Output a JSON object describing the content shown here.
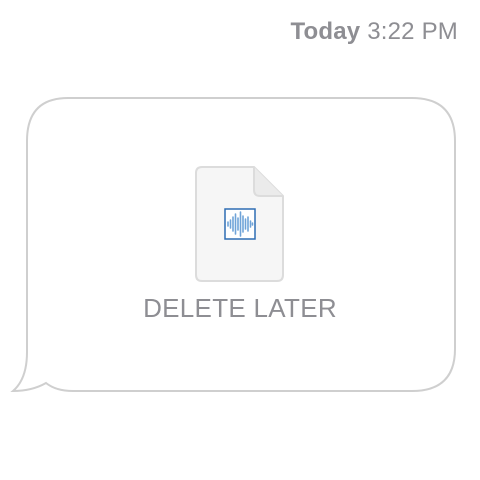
{
  "conversation": {
    "timestamp": {
      "day": "Today",
      "time": "3:22 PM"
    }
  },
  "message": {
    "attachment": {
      "type_icon": "audio-file-icon",
      "name": "DELETE LATER"
    }
  },
  "colors": {
    "bubble_border": "#cfcfcf",
    "meta_text": "#8e8e93",
    "file_fill": "#f6f6f6",
    "file_border": "#dcdcdc",
    "waveform": "#6fa3d8",
    "waveform_frame": "#2e6db4"
  }
}
